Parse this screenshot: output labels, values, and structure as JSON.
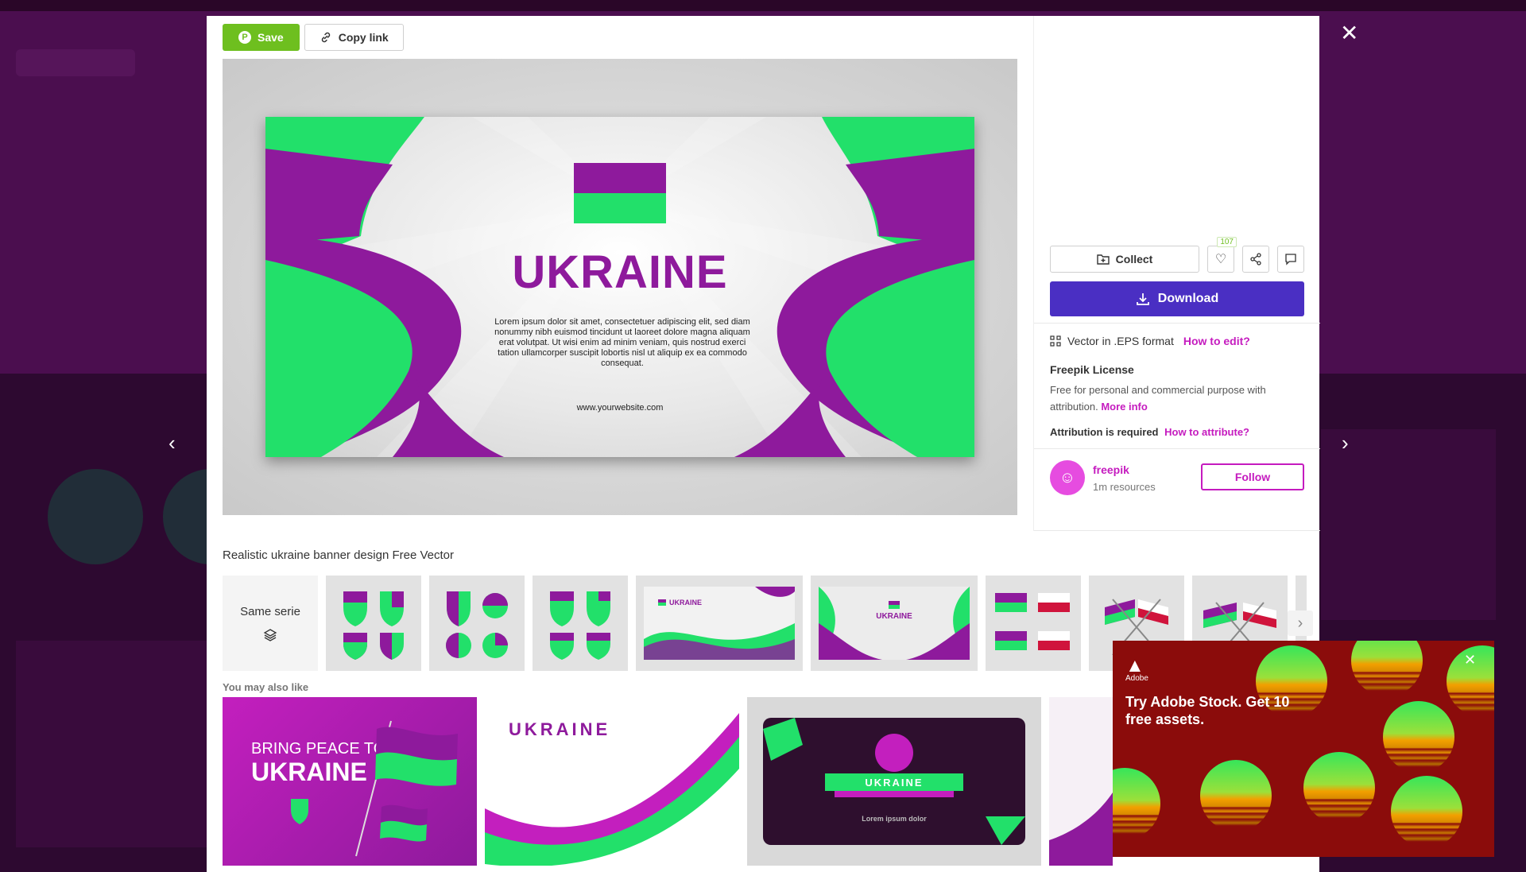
{
  "toolbar": {
    "save_label": "Save",
    "copy_link_label": "Copy link"
  },
  "preview": {
    "banner_title": "UKRAINE",
    "banner_body": "Lorem ipsum dolor sit amet, consectetuer adipiscing elit, sed diam nonummy nibh euismod tincidunt ut laoreet dolore magna aliquam erat volutpat. Ut wisi enim ad minim veniam, quis nostrud exerci tation ullamcorper suscipit lobortis nisl ut aliquip ex ea commodo consequat.",
    "banner_url": "www.yourwebsite.com"
  },
  "actions": {
    "collect_label": "Collect",
    "like_count": "107",
    "download_label": "Download"
  },
  "info": {
    "format_text": "Vector in .EPS format",
    "how_to_edit": "How to edit?",
    "license_title": "Freepik License",
    "license_desc": "Free for personal and commercial purpose with attribution.",
    "more_info": "More info",
    "attribution_text": "Attribution is required",
    "how_to_attribute": "How to attribute?"
  },
  "author": {
    "name": "freepik",
    "resources": "1m resources",
    "follow_label": "Follow"
  },
  "asset_title": "Realistic ukraine banner design Free Vector",
  "series": {
    "same_serie_label": "Same serie"
  },
  "also_like": {
    "heading": "You may also like",
    "rec1_title_line1": "BRING PEACE TO",
    "rec1_title_line2": "UKRAINE",
    "rec2_title": "UKRAINE",
    "rec3_title": "UKRAINE",
    "rec3_subtitle": "Lorem ipsum dolor"
  },
  "ad": {
    "brand": "Adobe",
    "headline": "Try Adobe Stock. Get 10 free assets."
  },
  "colors": {
    "purple": "#8e1a9c",
    "green": "#22e06a",
    "download_blue": "#4a2fc3",
    "save_green": "#6ebf1f",
    "accent_pink": "#c51bbf",
    "ad_red": "#8b0c0b"
  }
}
